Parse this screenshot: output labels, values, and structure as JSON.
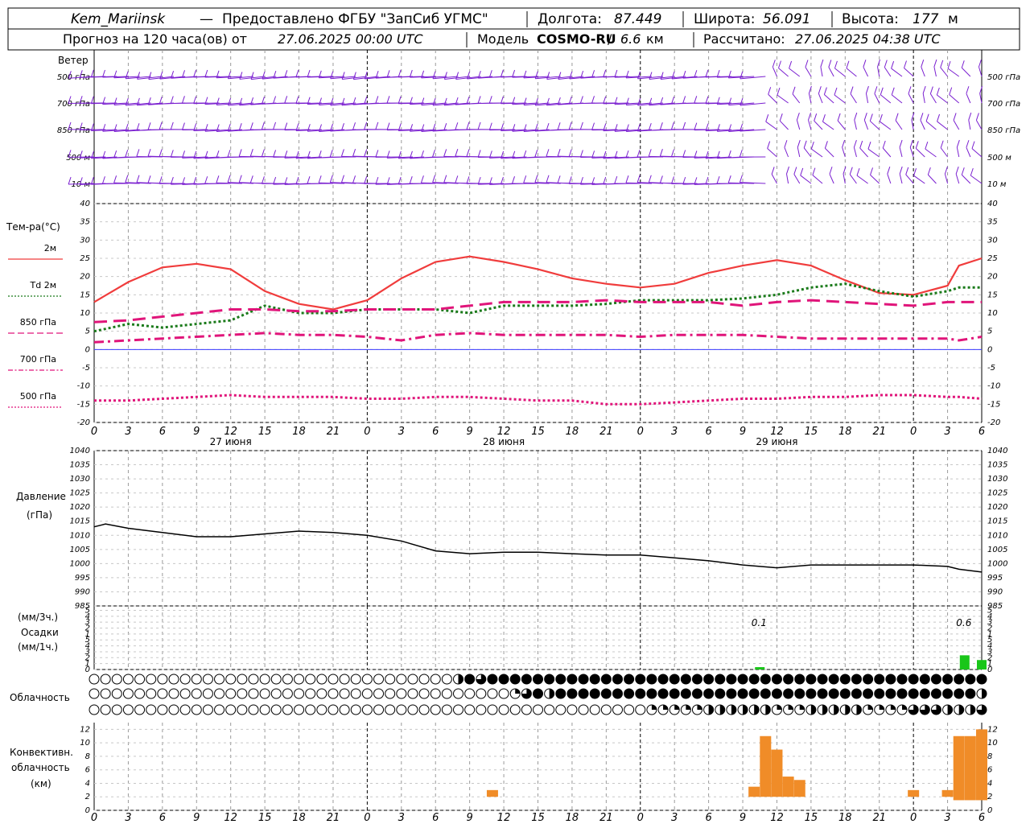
{
  "header": {
    "station": "Kem_Mariinsk",
    "dash": " — ",
    "provider": "Предоставлено ФГБУ \"ЗапСиб УГМС\"",
    "lon_label": "Долгота:",
    "lon_value": "87.449",
    "lat_label": "Широта:",
    "lat_value": "56.091",
    "alt_label": "Высота:",
    "alt_value": "177",
    "alt_unit": "м",
    "forecast_prefix": "Прогноз на 120 часа(ов) от",
    "forecast_start": "27.06.2025 00:00 UTC",
    "model_label": "Модель",
    "model_name": "COSMO-RU",
    "model_res": "6.6",
    "model_res_unit": "км",
    "computed_label": "Рассчитано:",
    "computed_value": "27.06.2025 04:38 UTC"
  },
  "colors": {
    "wind": "#7a1fd0",
    "t2m": "#f03c3c",
    "td2m": "#1a7a1a",
    "t850": "#e0157a",
    "t700": "#e0157a",
    "t500": "#e0157a",
    "zero_line": "#3a3aff",
    "pressure": "#000000",
    "precip": "#19c619",
    "convective": "#f08c28",
    "grid": "#9a9a9a"
  },
  "time_axis": {
    "hour_labels": [
      "0",
      "3",
      "6",
      "9",
      "12",
      "15",
      "18",
      "21",
      "0",
      "3",
      "6",
      "9",
      "12",
      "15",
      "18",
      "21",
      "0",
      "3",
      "6",
      "9",
      "12",
      "15",
      "18",
      "21",
      "0",
      "3",
      "6"
    ],
    "day_labels": [
      "27 июня",
      "28 июня",
      "29 июня"
    ]
  },
  "wind_panel": {
    "title": "Ветер",
    "levels_left": [
      "500 гПа",
      "700 гПа",
      "850 гПа",
      "500 м",
      "10 м"
    ],
    "levels_right": [
      "500 гПа",
      "700 гПа",
      "850 гПа",
      "500 м",
      "10 м"
    ]
  },
  "temp_panel": {
    "title": "Тем-ра(°C)",
    "legend": [
      "2м",
      "Td 2м",
      "850 гПа",
      "700 гПа",
      "500 гПа"
    ],
    "y_ticks": [
      "40",
      "35",
      "30",
      "25",
      "20",
      "15",
      "10",
      "5",
      "0",
      "-5",
      "-10",
      "-15",
      "-20"
    ]
  },
  "pressure_panel": {
    "title_line1": "Давление",
    "title_line2": "(гПа)",
    "y_ticks": [
      "1040",
      "1035",
      "1030",
      "1025",
      "1020",
      "1015",
      "1010",
      "1005",
      "1000",
      "995",
      "990",
      "985"
    ]
  },
  "precip_panel": {
    "unit_line1": "(мм/3ч.)",
    "title": "Осадки",
    "unit_line2": "(мм/1ч.)",
    "y_ticks": [
      "5",
      "4",
      "3",
      "2",
      "1",
      "5",
      "4",
      "3",
      "2",
      "1",
      "0"
    ],
    "annotations": [
      "0.1",
      "0.6"
    ]
  },
  "cloud_panel": {
    "title": "Облачность"
  },
  "conv_panel": {
    "title_line1": "Конвективн.",
    "title_line2": "облачность",
    "title_line3": "(км)",
    "y_ticks": [
      "12",
      "10",
      "8",
      "6",
      "4",
      "2",
      "0"
    ]
  },
  "chart_data": {
    "type": "line",
    "x_unit": "hours since 27.06.2025 00:00 UTC",
    "xlim": [
      0,
      78
    ],
    "temperature": {
      "ylim": [
        -20,
        40
      ],
      "series": [
        {
          "name": "2м",
          "x": [
            0,
            3,
            6,
            9,
            12,
            15,
            18,
            21,
            24,
            27,
            30,
            33,
            36,
            39,
            42,
            45,
            48,
            51,
            54,
            57,
            60,
            63,
            66,
            69,
            72,
            75,
            76,
            78
          ],
          "values": [
            13,
            18.5,
            22.5,
            23.5,
            22,
            16,
            12.5,
            11,
            13.5,
            19.5,
            24,
            25.5,
            24,
            22,
            19.5,
            18,
            17,
            18,
            21,
            23,
            24.5,
            23,
            19,
            15.5,
            15,
            17.5,
            23,
            25
          ]
        },
        {
          "name": "Td 2м",
          "x": [
            0,
            3,
            6,
            9,
            12,
            15,
            18,
            21,
            24,
            27,
            30,
            33,
            36,
            39,
            42,
            45,
            48,
            51,
            54,
            57,
            60,
            63,
            66,
            69,
            72,
            75,
            76,
            78
          ],
          "values": [
            5,
            7,
            6,
            7,
            8,
            12,
            10,
            10,
            11,
            11,
            11,
            10,
            12,
            12,
            12,
            12.5,
            13.5,
            13.5,
            13.5,
            14,
            15,
            17,
            18,
            16,
            14.5,
            16,
            17,
            17
          ]
        },
        {
          "name": "850 гПа",
          "x": [
            0,
            3,
            6,
            9,
            12,
            15,
            18,
            21,
            24,
            27,
            30,
            33,
            36,
            39,
            42,
            45,
            48,
            51,
            54,
            57,
            60,
            63,
            66,
            69,
            72,
            75,
            76,
            78
          ],
          "values": [
            7.5,
            8,
            9,
            10,
            11,
            11,
            10.5,
            10.5,
            11,
            11,
            11,
            12,
            13,
            13,
            13,
            13.5,
            13,
            13,
            13,
            12,
            13,
            13.5,
            13,
            12.5,
            12,
            13,
            13,
            13
          ]
        },
        {
          "name": "700 гПа",
          "x": [
            0,
            3,
            6,
            9,
            12,
            15,
            18,
            21,
            24,
            27,
            30,
            33,
            36,
            39,
            42,
            45,
            48,
            51,
            54,
            57,
            60,
            63,
            66,
            69,
            72,
            75,
            76,
            78
          ],
          "values": [
            2,
            2.5,
            3,
            3.5,
            4,
            4.5,
            4,
            4,
            3.5,
            2.5,
            4,
            4.5,
            4,
            4,
            4,
            4,
            3.5,
            4,
            4,
            4,
            3.5,
            3,
            3,
            3,
            3,
            3,
            2.5,
            3.5
          ]
        },
        {
          "name": "500 гПа",
          "x": [
            0,
            3,
            6,
            9,
            12,
            15,
            18,
            21,
            24,
            27,
            30,
            33,
            36,
            39,
            42,
            45,
            48,
            51,
            54,
            57,
            60,
            63,
            66,
            69,
            72,
            75,
            76,
            78
          ],
          "values": [
            -14,
            -14,
            -13.5,
            -13,
            -12.5,
            -13,
            -13,
            -13,
            -13.5,
            -13.5,
            -13,
            -13,
            -13.5,
            -14,
            -14,
            -15,
            -15,
            -14.5,
            -14,
            -13.5,
            -13.5,
            -13,
            -13,
            -12.5,
            -12.5,
            -13,
            -13,
            -13.5
          ]
        }
      ]
    },
    "pressure": {
      "ylim": [
        985,
        1040
      ],
      "x": [
        0,
        1,
        3,
        6,
        9,
        12,
        15,
        18,
        21,
        24,
        27,
        30,
        33,
        36,
        39,
        42,
        45,
        48,
        51,
        54,
        57,
        60,
        63,
        66,
        69,
        72,
        75,
        76,
        78
      ],
      "values": [
        1013,
        1014,
        1012.5,
        1011,
        1009.5,
        1009.5,
        1010.5,
        1011.5,
        1011,
        1010,
        1008,
        1004.5,
        1003.5,
        1004,
        1004,
        1003.5,
        1003,
        1003,
        1002,
        1001,
        999.5,
        998.5,
        999.5,
        999.5,
        999.5,
        999.5,
        999,
        998,
        997
      ]
    },
    "precipitation": {
      "unit": "мм/1ч.",
      "x": [
        58.5,
        76.5,
        78
      ],
      "values": [
        0.1,
        0.6,
        0.4
      ],
      "labels_at": [
        59,
        77
      ],
      "label_values": [
        "0.1",
        "0.6"
      ]
    },
    "convective_clouds": {
      "unit": "км",
      "ylim": [
        0,
        13
      ],
      "bars": [
        {
          "x": 35,
          "base": 2,
          "top": 3
        },
        {
          "x": 58,
          "base": 2,
          "top": 3.5
        },
        {
          "x": 59,
          "base": 2,
          "top": 11
        },
        {
          "x": 60,
          "base": 2,
          "top": 9
        },
        {
          "x": 61,
          "base": 2,
          "top": 5
        },
        {
          "x": 62,
          "base": 2,
          "top": 4.5
        },
        {
          "x": 72,
          "base": 2,
          "top": 3
        },
        {
          "x": 75,
          "base": 2,
          "top": 3
        },
        {
          "x": 76,
          "base": 1.5,
          "top": 11
        },
        {
          "x": 77,
          "base": 1.5,
          "top": 11
        },
        {
          "x": 78,
          "base": 1.5,
          "top": 12
        }
      ]
    },
    "cloud_cover_rows": {
      "row_names": [
        "upper",
        "middle",
        "lower"
      ],
      "fraction_by_row": [
        {
          "x": [
            0,
            31,
            32,
            33,
            34,
            35,
            36,
            78
          ],
          "values": [
            0,
            0,
            0.5,
            1,
            0.75,
            1,
            1,
            1
          ]
        },
        {
          "x": [
            0,
            36,
            37,
            38,
            39,
            40,
            41,
            54,
            78
          ],
          "values": [
            0,
            0,
            0.25,
            0.75,
            1,
            0.5,
            1,
            1,
            0.5
          ]
        },
        {
          "x": [
            0,
            34,
            49,
            54,
            60,
            63,
            68,
            72,
            75,
            78
          ],
          "values": [
            0,
            0,
            0.25,
            0.5,
            0.25,
            0.5,
            0.25,
            0.75,
            0.5,
            0.75
          ]
        }
      ]
    }
  }
}
